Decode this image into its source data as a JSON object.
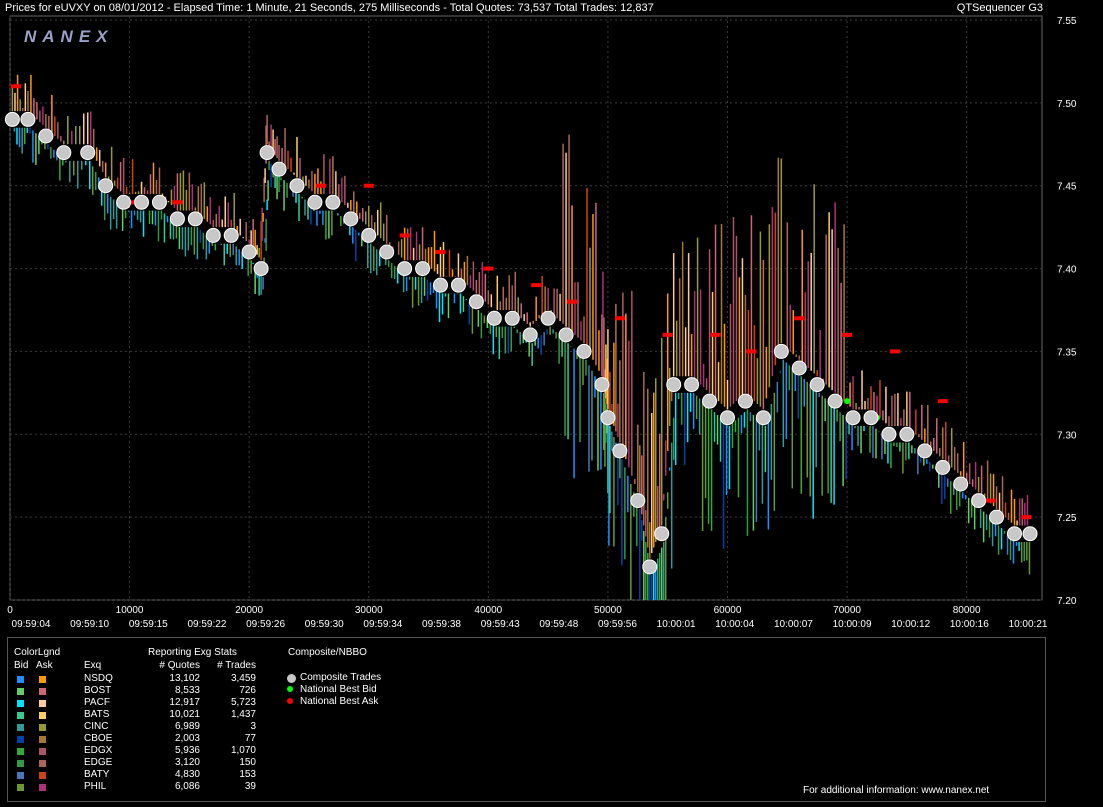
{
  "header": {
    "title": "Prices for  eUVXY  on  08/01/2012  -  Elapsed Time: 1 Minute, 21 Seconds, 275 Milliseconds  -  Total Quotes: 73,537  Total Trades: 12,837",
    "app_name": "QTSequencer G3",
    "logo": "NANEX"
  },
  "chart_data": {
    "type": "scatter",
    "title": "",
    "xlabel": "",
    "ylabel": "",
    "xlim": [
      0,
      86300
    ],
    "ylim": [
      7.2,
      7.55
    ],
    "y_ticks": [
      "7.55",
      "7.50",
      "7.45",
      "7.40",
      "7.35",
      "7.30",
      "7.25",
      "7.20"
    ],
    "x_ticks": [
      "0",
      "10000",
      "20000",
      "30000",
      "40000",
      "50000",
      "60000",
      "70000",
      "80000"
    ],
    "time_labels": [
      "09:59:04",
      "09:59:10",
      "09:59:15",
      "09:59:22",
      "09:59:26",
      "09:59:30",
      "09:59:34",
      "09:59:38",
      "09:59:43",
      "09:59:48",
      "09:59:56",
      "10:00:01",
      "10:00:04",
      "10:00:07",
      "10:00:09",
      "10:00:12",
      "10:00:16",
      "10:00:21"
    ],
    "grid": true,
    "series": [
      {
        "name": "Composite Trades",
        "color": "#c8c8c8",
        "points": [
          [
            200,
            7.49
          ],
          [
            1500,
            7.49
          ],
          [
            3000,
            7.48
          ],
          [
            4500,
            7.47
          ],
          [
            6500,
            7.47
          ],
          [
            8000,
            7.45
          ],
          [
            9500,
            7.44
          ],
          [
            11000,
            7.44
          ],
          [
            12500,
            7.44
          ],
          [
            14000,
            7.43
          ],
          [
            15500,
            7.43
          ],
          [
            17000,
            7.42
          ],
          [
            18500,
            7.42
          ],
          [
            20000,
            7.41
          ],
          [
            21000,
            7.4
          ],
          [
            21500,
            7.47
          ],
          [
            22500,
            7.46
          ],
          [
            24000,
            7.45
          ],
          [
            25500,
            7.44
          ],
          [
            27000,
            7.44
          ],
          [
            28500,
            7.43
          ],
          [
            30000,
            7.42
          ],
          [
            31500,
            7.41
          ],
          [
            33000,
            7.4
          ],
          [
            34500,
            7.4
          ],
          [
            36000,
            7.39
          ],
          [
            37500,
            7.39
          ],
          [
            39000,
            7.38
          ],
          [
            40500,
            7.37
          ],
          [
            42000,
            7.37
          ],
          [
            43500,
            7.36
          ],
          [
            45000,
            7.37
          ],
          [
            46500,
            7.36
          ],
          [
            48000,
            7.35
          ],
          [
            49500,
            7.33
          ],
          [
            50000,
            7.31
          ],
          [
            51000,
            7.29
          ],
          [
            52500,
            7.26
          ],
          [
            53500,
            7.22
          ],
          [
            54500,
            7.24
          ],
          [
            55500,
            7.33
          ],
          [
            57000,
            7.33
          ],
          [
            58500,
            7.32
          ],
          [
            60000,
            7.31
          ],
          [
            61500,
            7.32
          ],
          [
            63000,
            7.31
          ],
          [
            64500,
            7.35
          ],
          [
            66000,
            7.34
          ],
          [
            67500,
            7.33
          ],
          [
            69000,
            7.32
          ],
          [
            70500,
            7.31
          ],
          [
            72000,
            7.31
          ],
          [
            73500,
            7.3
          ],
          [
            75000,
            7.3
          ],
          [
            76500,
            7.29
          ],
          [
            78000,
            7.28
          ],
          [
            79500,
            7.27
          ],
          [
            81000,
            7.26
          ],
          [
            82500,
            7.25
          ],
          [
            84000,
            7.24
          ],
          [
            85300,
            7.24
          ]
        ]
      },
      {
        "name": "National Best Bid",
        "color": "#00ff00",
        "points": [
          [
            64800,
            7.35
          ],
          [
            70000,
            7.32
          ],
          [
            72500,
            7.31
          ]
        ]
      },
      {
        "name": "National Best Ask",
        "color": "#ff0000",
        "points": [
          [
            500,
            7.51
          ],
          [
            10000,
            7.44
          ],
          [
            14000,
            7.44
          ],
          [
            26000,
            7.45
          ],
          [
            30000,
            7.45
          ],
          [
            33000,
            7.42
          ],
          [
            36000,
            7.41
          ],
          [
            40000,
            7.4
          ],
          [
            44000,
            7.39
          ],
          [
            47000,
            7.38
          ],
          [
            51000,
            7.37
          ],
          [
            55000,
            7.36
          ],
          [
            59000,
            7.36
          ],
          [
            62000,
            7.35
          ],
          [
            66000,
            7.37
          ],
          [
            70000,
            7.36
          ],
          [
            74000,
            7.35
          ],
          [
            78000,
            7.32
          ],
          [
            82000,
            7.26
          ],
          [
            85000,
            7.25
          ]
        ]
      }
    ]
  },
  "legend": {
    "color_legend_title": "ColorLgnd",
    "bid_header": "Bid",
    "ask_header": "Ask",
    "exq_header": "Exq",
    "stats_title": "Reporting Exg Stats",
    "quotes_header": "# Quotes",
    "trades_header": "# Trades",
    "nbbo_title": "Composite/NBBO",
    "nbbo_items": [
      {
        "label": "Composite Trades",
        "color": "#c8c8c8"
      },
      {
        "label": "National Best Bid",
        "color": "#00ff00"
      },
      {
        "label": "National Best Ask",
        "color": "#ff0000"
      }
    ],
    "exchanges": [
      {
        "exq": "NSDQ",
        "quotes": "13,102",
        "trades": "3,459",
        "bid_color": "#1e90ff",
        "ask_color": "#ff9900"
      },
      {
        "exq": "BOST",
        "quotes": "8,533",
        "trades": "726",
        "bid_color": "#66cc66",
        "ask_color": "#cc6677"
      },
      {
        "exq": "PACF",
        "quotes": "12,917",
        "trades": "5,723",
        "bid_color": "#00e5ff",
        "ask_color": "#ffcc99"
      },
      {
        "exq": "BATS",
        "quotes": "10,021",
        "trades": "1,437",
        "bid_color": "#33cc99",
        "ask_color": "#ffcc66"
      },
      {
        "exq": "CINC",
        "quotes": "6,989",
        "trades": "3",
        "bid_color": "#339999",
        "ask_color": "#999933"
      },
      {
        "exq": "CBOE",
        "quotes": "2,003",
        "trades": "77",
        "bid_color": "#0044aa",
        "ask_color": "#aa7733"
      },
      {
        "exq": "EDGX",
        "quotes": "5,936",
        "trades": "1,070",
        "bid_color": "#33aa33",
        "ask_color": "#aa5566"
      },
      {
        "exq": "EDGE",
        "quotes": "3,120",
        "trades": "150",
        "bid_color": "#339944",
        "ask_color": "#aa6655"
      },
      {
        "exq": "BATY",
        "quotes": "4,830",
        "trades": "153",
        "bid_color": "#4477bb",
        "ask_color": "#cc4411"
      },
      {
        "exq": "PHIL",
        "quotes": "6,086",
        "trades": "39",
        "bid_color": "#669933",
        "ask_color": "#aa3377"
      }
    ],
    "footer": "For additional information: www.nanex.net"
  }
}
